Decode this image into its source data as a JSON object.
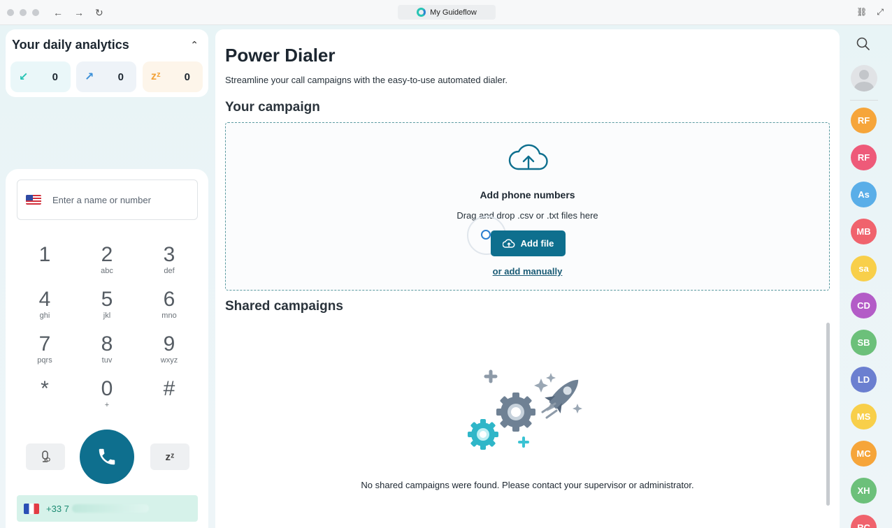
{
  "browser": {
    "title": "My Guideflow",
    "back_icon": "←",
    "forward_icon": "→",
    "reload_icon": "↻",
    "link_icon": "⛓",
    "expand_icon": "⤢"
  },
  "analytics": {
    "title": "Your daily analytics",
    "collapse_icon": "⌃",
    "stats": [
      {
        "icon": "incoming-call-icon",
        "glyph": "↙",
        "value": "0",
        "color": "#27c4b4"
      },
      {
        "icon": "outgoing-call-icon",
        "glyph": "↗",
        "value": "0",
        "color": "#3a8fd8"
      },
      {
        "icon": "snooze-icon",
        "glyph": "zᶻ",
        "value": "0",
        "color": "#f2a33a"
      }
    ]
  },
  "dialer": {
    "placeholder": "Enter a name or number",
    "keys": [
      {
        "d": "1",
        "l": ""
      },
      {
        "d": "2",
        "l": "abc"
      },
      {
        "d": "3",
        "l": "def"
      },
      {
        "d": "4",
        "l": "ghi"
      },
      {
        "d": "5",
        "l": "jkl"
      },
      {
        "d": "6",
        "l": "mno"
      },
      {
        "d": "7",
        "l": "pqrs"
      },
      {
        "d": "8",
        "l": "tuv"
      },
      {
        "d": "9",
        "l": "wxyz"
      },
      {
        "d": "*",
        "l": ""
      },
      {
        "d": "0",
        "l": "+"
      },
      {
        "d": "#",
        "l": ""
      }
    ],
    "snooze_label": "zᶻ",
    "caller_id_prefix": "+33 7"
  },
  "main": {
    "title": "Power Dialer",
    "subtitle": "Streamline your call campaigns with the easy-to-use automated dialer.",
    "your_campaign": "Your campaign",
    "dropzone": {
      "title": "Add phone numbers",
      "hint": "Drag and drop .csv or .txt files here",
      "button": "Add file",
      "manual_link": "or add manually"
    },
    "shared_campaigns": "Shared campaigns",
    "empty_message": "No shared campaigns were found. Please contact your supervisor or administrator."
  },
  "colors": {
    "accent": "#0e6f8e",
    "dashed_border": "#5a9aa0"
  },
  "rail": {
    "avatars": [
      {
        "initials": "RF",
        "color": "#f6a53a"
      },
      {
        "initials": "RF",
        "color": "#ee5a79"
      },
      {
        "initials": "As",
        "color": "#5aaee8"
      },
      {
        "initials": "MB",
        "color": "#f0636d"
      },
      {
        "initials": "sa",
        "color": "#f8cf4a"
      },
      {
        "initials": "CD",
        "color": "#b35cc7"
      },
      {
        "initials": "SB",
        "color": "#6cc07a"
      },
      {
        "initials": "LD",
        "color": "#6b7fd0"
      },
      {
        "initials": "MS",
        "color": "#f8cf4a"
      },
      {
        "initials": "MC",
        "color": "#f6a53a"
      },
      {
        "initials": "XH",
        "color": "#6cc07a"
      },
      {
        "initials": "RC",
        "color": "#f0636d"
      }
    ]
  }
}
